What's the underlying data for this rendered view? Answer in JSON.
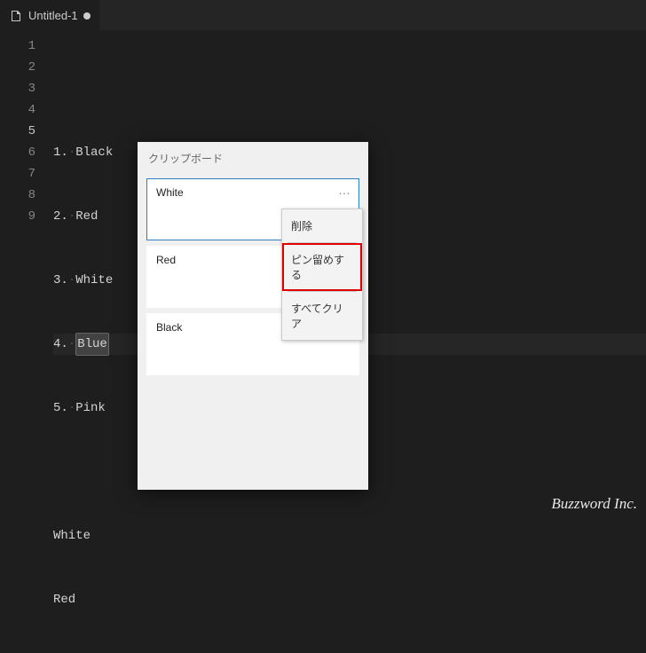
{
  "tab": {
    "title": "Untitled-1",
    "modified": true
  },
  "editor": {
    "active_line": 5,
    "lines": [
      {
        "num": 1,
        "text": ""
      },
      {
        "num": 2,
        "text": "1. Black",
        "prefix": "1.",
        "item": "Black"
      },
      {
        "num": 3,
        "text": "2. Red",
        "prefix": "2.",
        "item": "Red"
      },
      {
        "num": 4,
        "text": "3. White",
        "prefix": "3.",
        "item": "White"
      },
      {
        "num": 5,
        "text": "4. Blue",
        "prefix": "4.",
        "item": "Blue",
        "caret": true
      },
      {
        "num": 6,
        "text": "5. Pink",
        "prefix": "5.",
        "item": "Pink"
      },
      {
        "num": 7,
        "text": ""
      },
      {
        "num": 8,
        "text": "White",
        "item": "White"
      },
      {
        "num": 9,
        "text": "Red",
        "item": "Red"
      }
    ]
  },
  "clipboard": {
    "title": "クリップボード",
    "entries": [
      {
        "text": "White",
        "selected": true
      },
      {
        "text": "Red",
        "selected": false
      },
      {
        "text": "Black",
        "selected": false
      }
    ],
    "more_glyph": "…"
  },
  "context_menu": {
    "items": [
      {
        "label": "削除",
        "highlight": false
      },
      {
        "label": "ピン留めする",
        "highlight": true
      },
      {
        "label": "すべてクリア",
        "highlight": false
      }
    ]
  },
  "watermark": "Buzzword Inc."
}
